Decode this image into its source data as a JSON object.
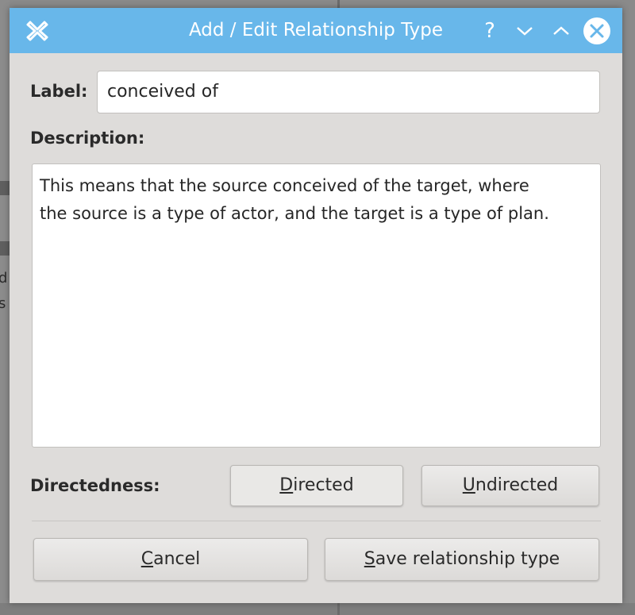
{
  "window": {
    "title": "Add / Edit Relationship Type",
    "help_glyph": "?",
    "titlebar_color": "#68b7ea",
    "icons": {
      "app": "close-x-app-icon",
      "minimize": "chevron-down-icon",
      "maximize": "chevron-up-icon",
      "close": "close-circle-icon"
    }
  },
  "form": {
    "label_caption": "Label:",
    "label_value": "conceived of",
    "description_caption": "Description:",
    "description_value": "This means that the source conceived of the target, where\nthe source is a type of actor, and the target is a type of plan.",
    "directedness_caption": "Directedness:"
  },
  "buttons": {
    "directed": {
      "mnemonic": "D",
      "rest": "irected"
    },
    "undirected": {
      "mnemonic": "U",
      "rest": "ndirected"
    },
    "cancel": {
      "mnemonic": "C",
      "rest": "ancel"
    },
    "save": {
      "mnemonic": "S",
      "rest": "ave relationship type"
    }
  },
  "background": {
    "fragment_1": "d",
    "fragment_2": "s"
  }
}
